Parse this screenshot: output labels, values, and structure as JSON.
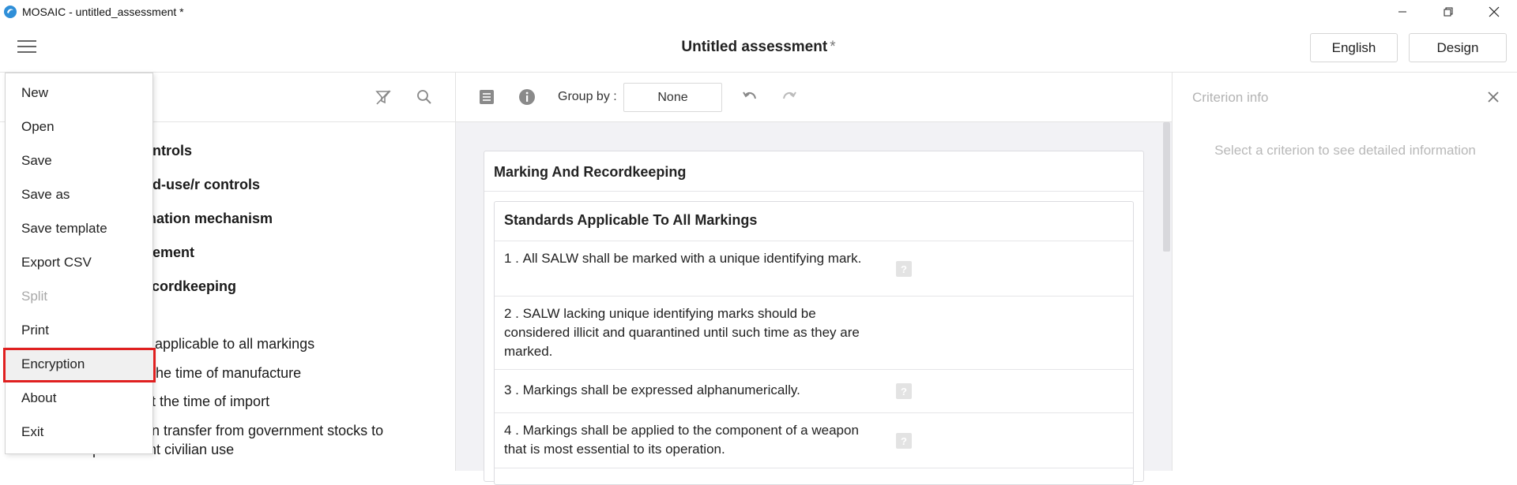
{
  "window": {
    "title": "MOSAIC - untitled_assessment *"
  },
  "header": {
    "doc_title": "Untitled assessment",
    "modified_marker": "*",
    "language_button": "English",
    "mode_button": "Design"
  },
  "left_tree": {
    "items": [
      {
        "text": "ontrols",
        "bold": true
      },
      {
        "text": "nd-use/r controls",
        "bold": true
      },
      {
        "text": "ination mechanism",
        "bold": true
      },
      {
        "text": "gement",
        "bold": true
      },
      {
        "text": "ecordkeeping",
        "bold": true
      },
      {
        "text": "s applicable to all markings",
        "bold": false
      },
      {
        "text": "t the time of manufacture",
        "bold": false
      },
      {
        "text": "at the time of import",
        "bold": false
      },
      {
        "text": "on transfer from government stocks to",
        "bold": false
      },
      {
        "text": "permanent civilian use",
        "bold": false
      }
    ]
  },
  "toolbar": {
    "group_by_label": "Group by :",
    "group_by_value": "None"
  },
  "content": {
    "section_title": "Marking And Recordkeeping",
    "subsection_title": "Standards Applicable To All Markings",
    "criteria": [
      {
        "num": "1 .",
        "text": "All SALW shall be marked with a unique identifying mark."
      },
      {
        "num": "2 .",
        "text": "SALW lacking unique identifying marks should be considered illicit and quarantined until such time as they are marked."
      },
      {
        "num": "3 .",
        "text": "Markings shall be expressed alphanumerically."
      },
      {
        "num": "4 .",
        "text": "Markings shall be applied to the component of a weapon that is most essential to its operation."
      }
    ],
    "help_glyph": "?"
  },
  "right_panel": {
    "title": "Criterion info",
    "hint": "Select a criterion to see detailed information"
  },
  "menu": {
    "items": [
      {
        "label": "New",
        "disabled": false
      },
      {
        "label": "Open",
        "disabled": false
      },
      {
        "label": "Save",
        "disabled": false
      },
      {
        "label": "Save as",
        "disabled": false
      },
      {
        "label": "Save template",
        "disabled": false
      },
      {
        "label": "Export CSV",
        "disabled": false
      },
      {
        "label": "Split",
        "disabled": true
      },
      {
        "label": "Print",
        "disabled": false
      },
      {
        "label": "Encryption",
        "disabled": false,
        "highlighted": true
      },
      {
        "label": "About",
        "disabled": false
      },
      {
        "label": "Exit",
        "disabled": false
      }
    ]
  },
  "colors": {
    "highlight_border": "#e02020",
    "app_icon": "#2f8fd8"
  }
}
